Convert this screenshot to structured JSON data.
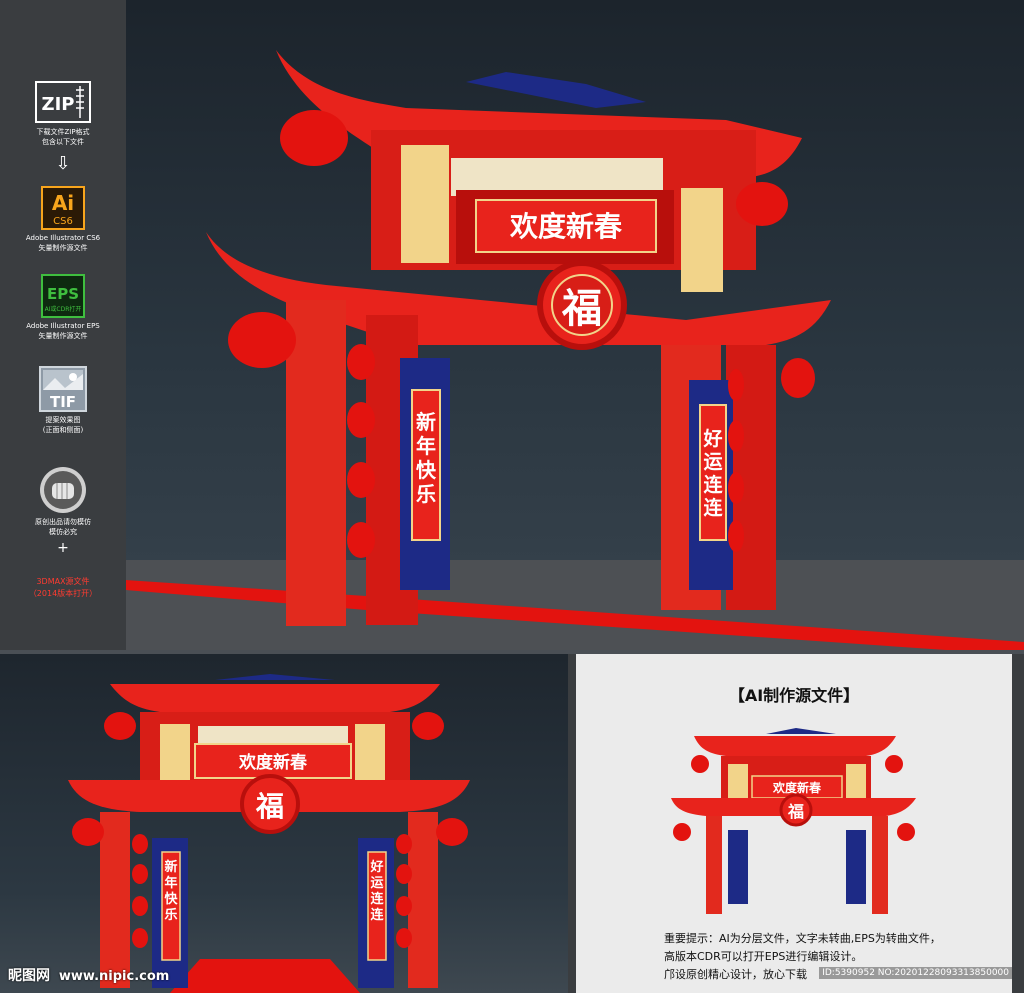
{
  "sidebar": {
    "zip": {
      "icon": "zip-icon",
      "label": "ZIP",
      "caption1": "下载文件ZIP格式",
      "caption2": "包含以下文件"
    },
    "arrow": "⇩",
    "ai": {
      "icon": "ai-icon",
      "label": "Ai",
      "sub": "CS6",
      "caption1": "Adobe Illustrator CS6",
      "caption2": "矢量制作源文件"
    },
    "eps": {
      "icon": "eps-icon",
      "label": "EPS",
      "sub": "AI或CDR打开",
      "caption1": "Adobe Illustrator EPS",
      "caption2": "矢量制作源文件"
    },
    "tif": {
      "icon": "tif-icon",
      "label": "TIF",
      "caption1": "提案效果图",
      "caption2": "(正面和侧面)"
    },
    "fist": {
      "icon": "fist-icon",
      "caption1": "原创出品请勿模仿",
      "caption2": "模仿必究"
    },
    "plus": "+",
    "max": {
      "caption1": "3DMAX源文件",
      "caption2": "（2014版本打开）"
    }
  },
  "arch": {
    "title": "欢度新春",
    "fu": "福",
    "left_couplet": "新年快乐",
    "right_couplet": "好运连连"
  },
  "ai_panel": {
    "title": "【AI制作源文件】",
    "note_line1": "重要提示：AI为分层文件，文字未转曲,EPS为转曲文件，",
    "note_line2": "高版本CDR可以打开EPS进行编辑设计。",
    "note_line3": "邝设原创精心设计，放心下载"
  },
  "watermark": {
    "logo": "昵图网",
    "url": "www.nipic.com",
    "id": "ID:5390952 NO:20201228093313850000"
  },
  "colors": {
    "red": "#e8231c",
    "dark_red": "#b80f0c",
    "gold": "#f2d48a",
    "navy": "#1d2a86",
    "bg": "#24292e"
  }
}
